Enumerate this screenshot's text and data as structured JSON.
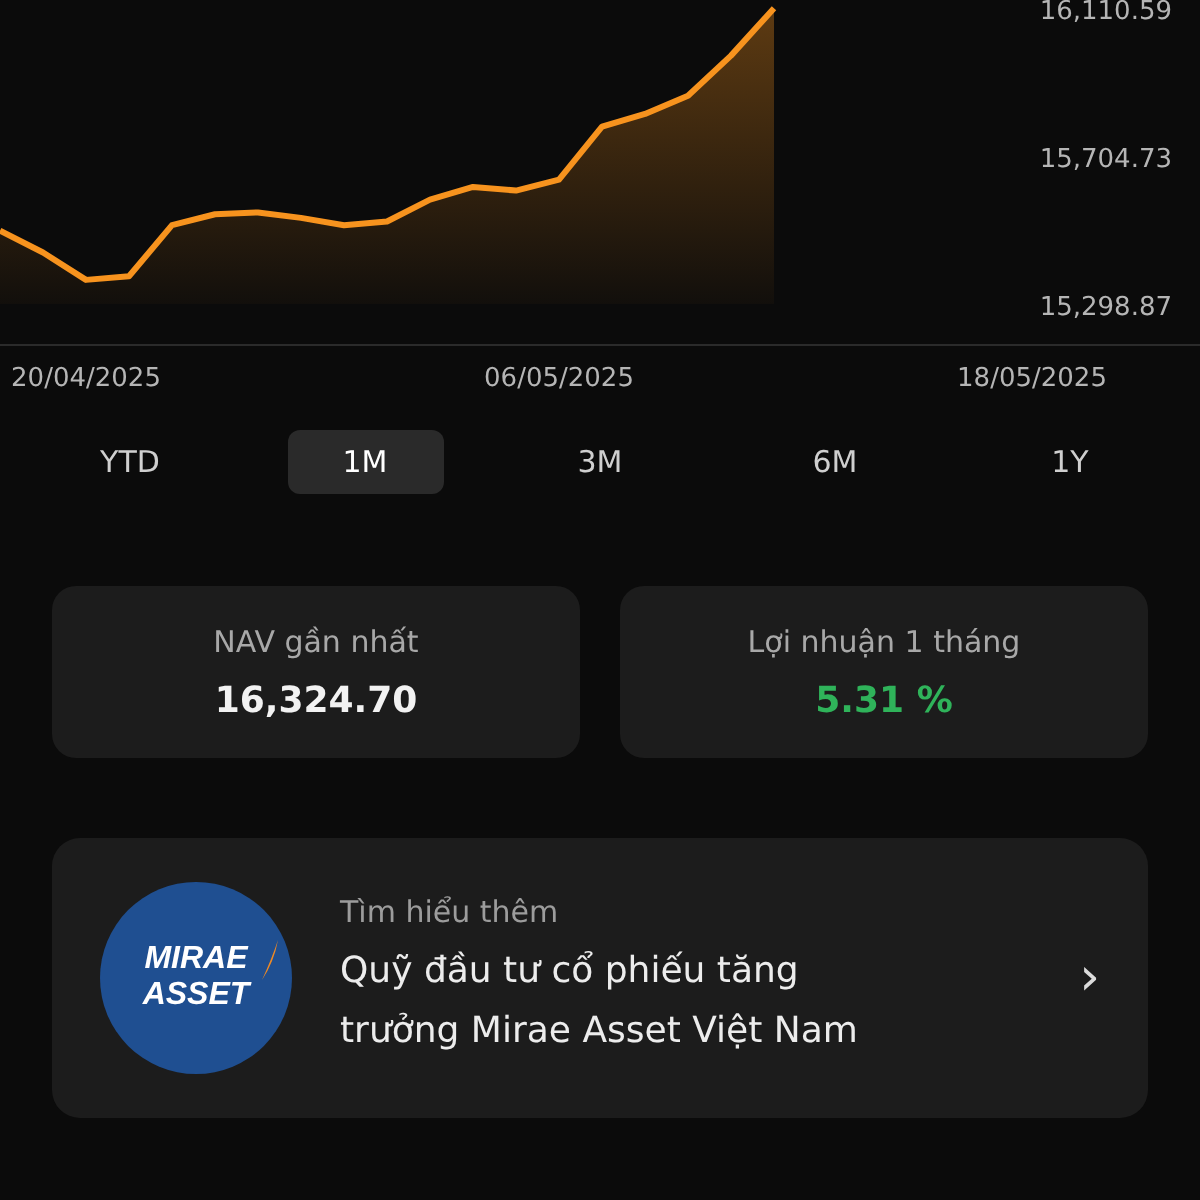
{
  "chart": {
    "chart_data": {
      "type": "area",
      "categories": [
        null,
        null,
        "20/04/2025",
        null,
        null,
        null,
        null,
        null,
        null,
        null,
        null,
        null,
        null,
        "06/05/2025",
        null,
        null,
        null,
        null,
        null,
        null,
        null,
        null,
        null,
        null,
        "18/05/2025"
      ],
      "ylim": [
        15298.87,
        16110.59
      ],
      "series": [
        {
          "color": "#f7931e",
          "values": [
            15500,
            15440,
            15365,
            15375,
            15515,
            15545,
            15550,
            15535,
            15515,
            15525,
            15585,
            15620,
            15610,
            15640,
            15785,
            15820,
            15870,
            15980,
            16110,
            null,
            null,
            null,
            null,
            null,
            null
          ]
        }
      ],
      "yticks": [
        {
          "value": 16110.59,
          "label": "16,110.59"
        },
        {
          "value": 15704.73,
          "label": "15,704.73"
        },
        {
          "value": 15298.87,
          "label": "15,298.87"
        }
      ]
    }
  },
  "periods": [
    {
      "label": "YTD",
      "selected": false
    },
    {
      "label": "1M",
      "selected": true
    },
    {
      "label": "3M",
      "selected": false
    },
    {
      "label": "6M",
      "selected": false
    },
    {
      "label": "1Y",
      "selected": false
    }
  ],
  "stats": [
    {
      "label": "NAV gần nhất",
      "value": "16,324.70",
      "kind": "plain"
    },
    {
      "label": "Lợi nhuận 1 tháng",
      "value": "5.31 %",
      "kind": "gain"
    }
  ],
  "fund_card": {
    "logo": [
      "MIRAE",
      "ASSET"
    ],
    "caption": "Tìm hiểu thêm",
    "title": "Quỹ đầu tư cổ phiếu tăng trưởng Mirae Asset Việt Nam",
    "chevron": "›"
  }
}
